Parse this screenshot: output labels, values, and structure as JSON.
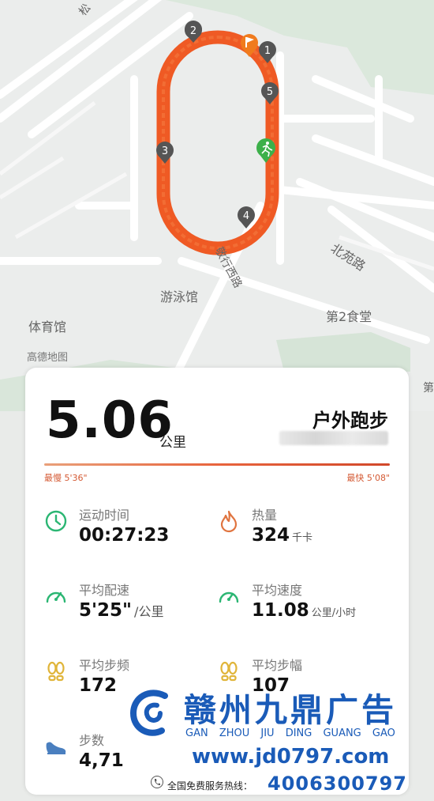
{
  "map": {
    "labels": {
      "pool": "游泳馆",
      "gym": "体育馆",
      "canteen": "第2食堂",
      "road_beiyuan": "北苑路",
      "road_xingzheng": "敬行西路",
      "road_top": "松",
      "road_right": "第",
      "attribution": "高德地图"
    },
    "markers": [
      "1",
      "2",
      "3",
      "4",
      "5"
    ],
    "track_color": "#ef5a24",
    "start_color": "#f07b1d",
    "runner_color": "#3cb04a"
  },
  "summary": {
    "distance": "5.06",
    "distance_unit": "公里",
    "activity_type": "户外跑步",
    "slowest": "最慢 5'36\"",
    "fastest": "最快 5'08\""
  },
  "stats": {
    "time": {
      "label": "运动时间",
      "value": "00:27:23",
      "unit": ""
    },
    "calories": {
      "label": "热量",
      "value": "324",
      "unit": "千卡"
    },
    "avg_pace": {
      "label": "平均配速",
      "value": "5'25\"",
      "unit": "/公里"
    },
    "avg_speed": {
      "label": "平均速度",
      "value": "11.08",
      "unit": "公里/小时"
    },
    "cadence": {
      "label": "平均步频",
      "value": "172",
      "unit": ""
    },
    "stride": {
      "label": "平均步幅",
      "value": "107",
      "unit": ""
    },
    "steps": {
      "label": "步数",
      "value": "4,71",
      "unit": ""
    }
  },
  "ad": {
    "name": "赣州九鼎广告",
    "pinyin": "GAN ZHOU JIU DING GUANG GAO",
    "url": "www.jd0797.com",
    "hotline_label": "全国免费服务热线：",
    "hotline": "4006300797"
  },
  "colors": {
    "accent": "#d45a34",
    "ad_blue": "#1a5bb8",
    "green": "#2bb673"
  }
}
